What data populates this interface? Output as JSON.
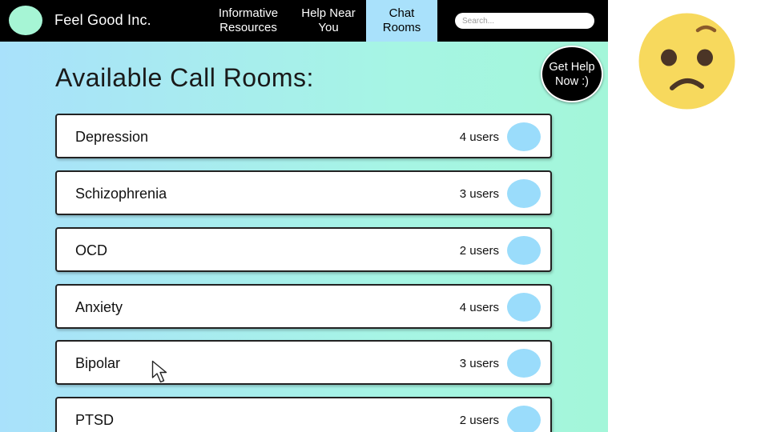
{
  "header": {
    "brand": "Feel Good Inc.",
    "nav": [
      {
        "line1": "Informative",
        "line2": "Resources"
      },
      {
        "line1": "Help Near",
        "line2": "You"
      },
      {
        "line1": "Chat",
        "line2": "Rooms"
      }
    ],
    "search_placeholder": "Search..."
  },
  "help_button": {
    "line1": "Get Help",
    "line2": "Now :)"
  },
  "page_title": "Available Call Rooms:",
  "rooms": [
    {
      "name": "Depression",
      "users": "4 users"
    },
    {
      "name": "Schizophrenia",
      "users": "3 users"
    },
    {
      "name": "OCD",
      "users": "2 users"
    },
    {
      "name": "Anxiety",
      "users": "4 users"
    },
    {
      "name": "Bipolar",
      "users": "3 users"
    },
    {
      "name": "PTSD",
      "users": "2 users"
    }
  ],
  "icons": {
    "logo": "logo-circle",
    "cursor": "mouse-pointer-icon",
    "emoji": "worried-face-emoji"
  },
  "colors": {
    "header_bg": "#000000",
    "active_tab": "#a9e1fb",
    "logo": "#a6f5d5",
    "join_button": "#9adcfb",
    "gradient_left": "#a9e1fb",
    "gradient_right": "#a3f6d9",
    "emoji_face": "#f7d95d"
  }
}
